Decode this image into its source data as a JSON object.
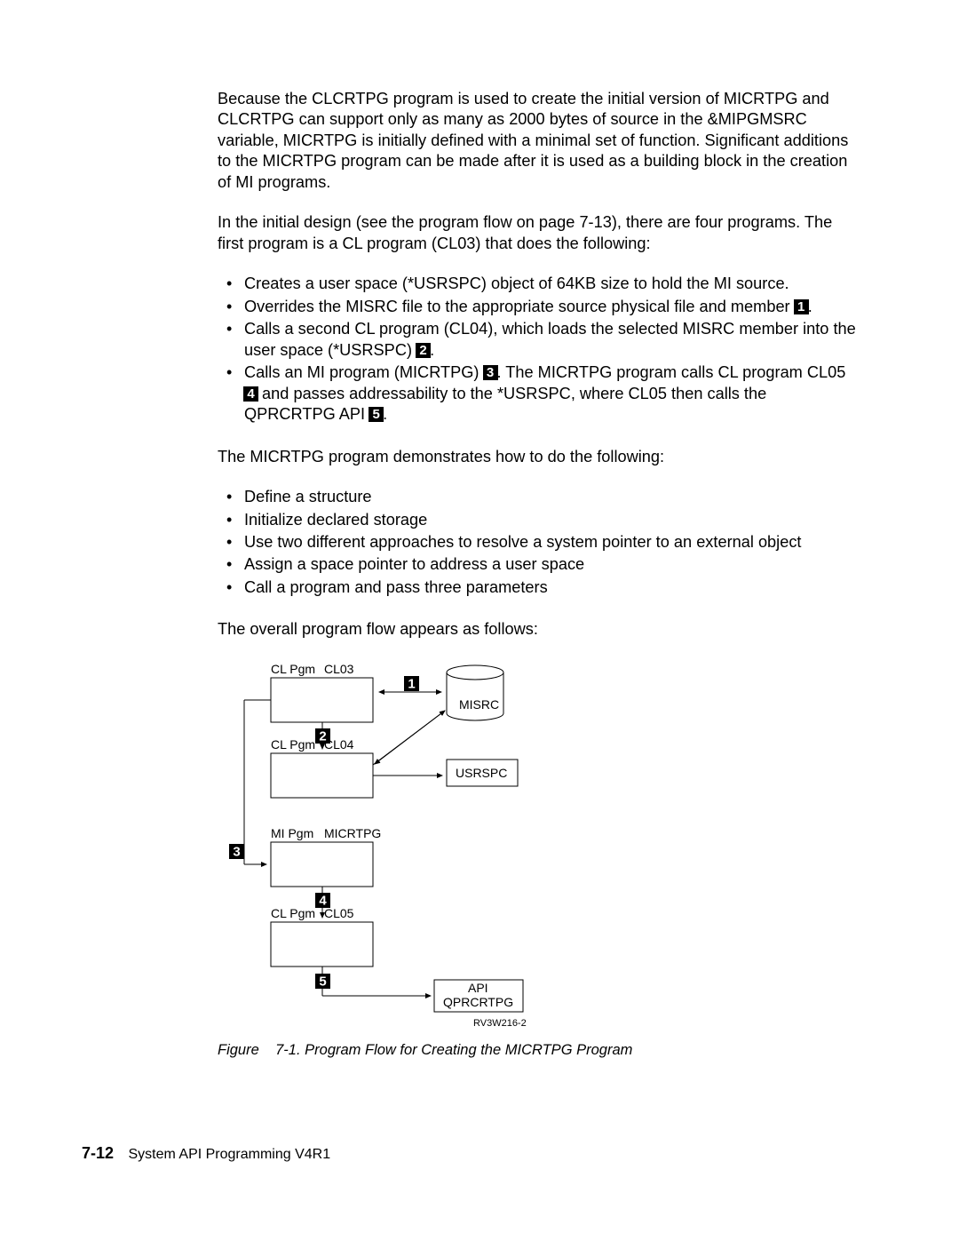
{
  "para1": "Because the CLCRTPG program is used to create the initial version of MICRTPG and CLCRTPG can support only as many as 2000 bytes of source in the &MIPGMSRC variable, MICRTPG is initially defined with a minimal set of function. Significant additions to the MICRTPG program can be made after it is used as a building block in the creation of MI programs.",
  "para2": "In the initial design (see the program flow on page 7-13), there are four programs. The first program is a CL program (CL03) that does the following:",
  "list1": {
    "i1": "Creates a user space (*USRSPC) object of 64KB size to hold the MI source.",
    "i2a": "Overrides the MISRC file to the appropriate source physical file and member",
    "i3a": "Calls a second CL program (CL04), which loads the selected MISRC member into the user space (*USRSPC)",
    "i4a": "Calls an MI program (MICRTPG)",
    "i4b": ".  The MICRTPG program calls CL program CL05",
    "i4c": " and passes addressability to the *USRSPC, where CL05 then calls the QPRCRTPG API"
  },
  "para3": "The MICRTPG program demonstrates how to do the following:",
  "list2": {
    "i1": "Define a structure",
    "i2": "Initialize declared storage",
    "i3": "Use two different approaches to resolve a system pointer to an external object",
    "i4": "Assign a space pointer to address a user space",
    "i5": "Call a program and pass three parameters"
  },
  "para4": "The overall program flow appears as follows:",
  "diagram": {
    "cl03_label_l": "CL Pgm",
    "cl03_label_r": "CL03",
    "cl04_label_l": "CL Pgm",
    "cl04_label_r": "CL04",
    "mi_label_l": "MI Pgm",
    "mi_label_r": "MICRTPG",
    "cl05_label_l": "CL Pgm",
    "cl05_label_r": "CL05",
    "misrc": "MISRC",
    "usrspc": "USRSPC",
    "api1": "API",
    "api2": "QPRCRTPG",
    "rv": "RV3W216-2",
    "c1": "1",
    "c2": "2",
    "c3": "3",
    "c4": "4",
    "c5": "5"
  },
  "caption_label": "Figure",
  "caption_num": "7-1.",
  "caption_text": "Program Flow for Creating the MICRTPG Program",
  "footer_page": "7-12",
  "footer_text": "System API Programming V4R1",
  "dot": "."
}
